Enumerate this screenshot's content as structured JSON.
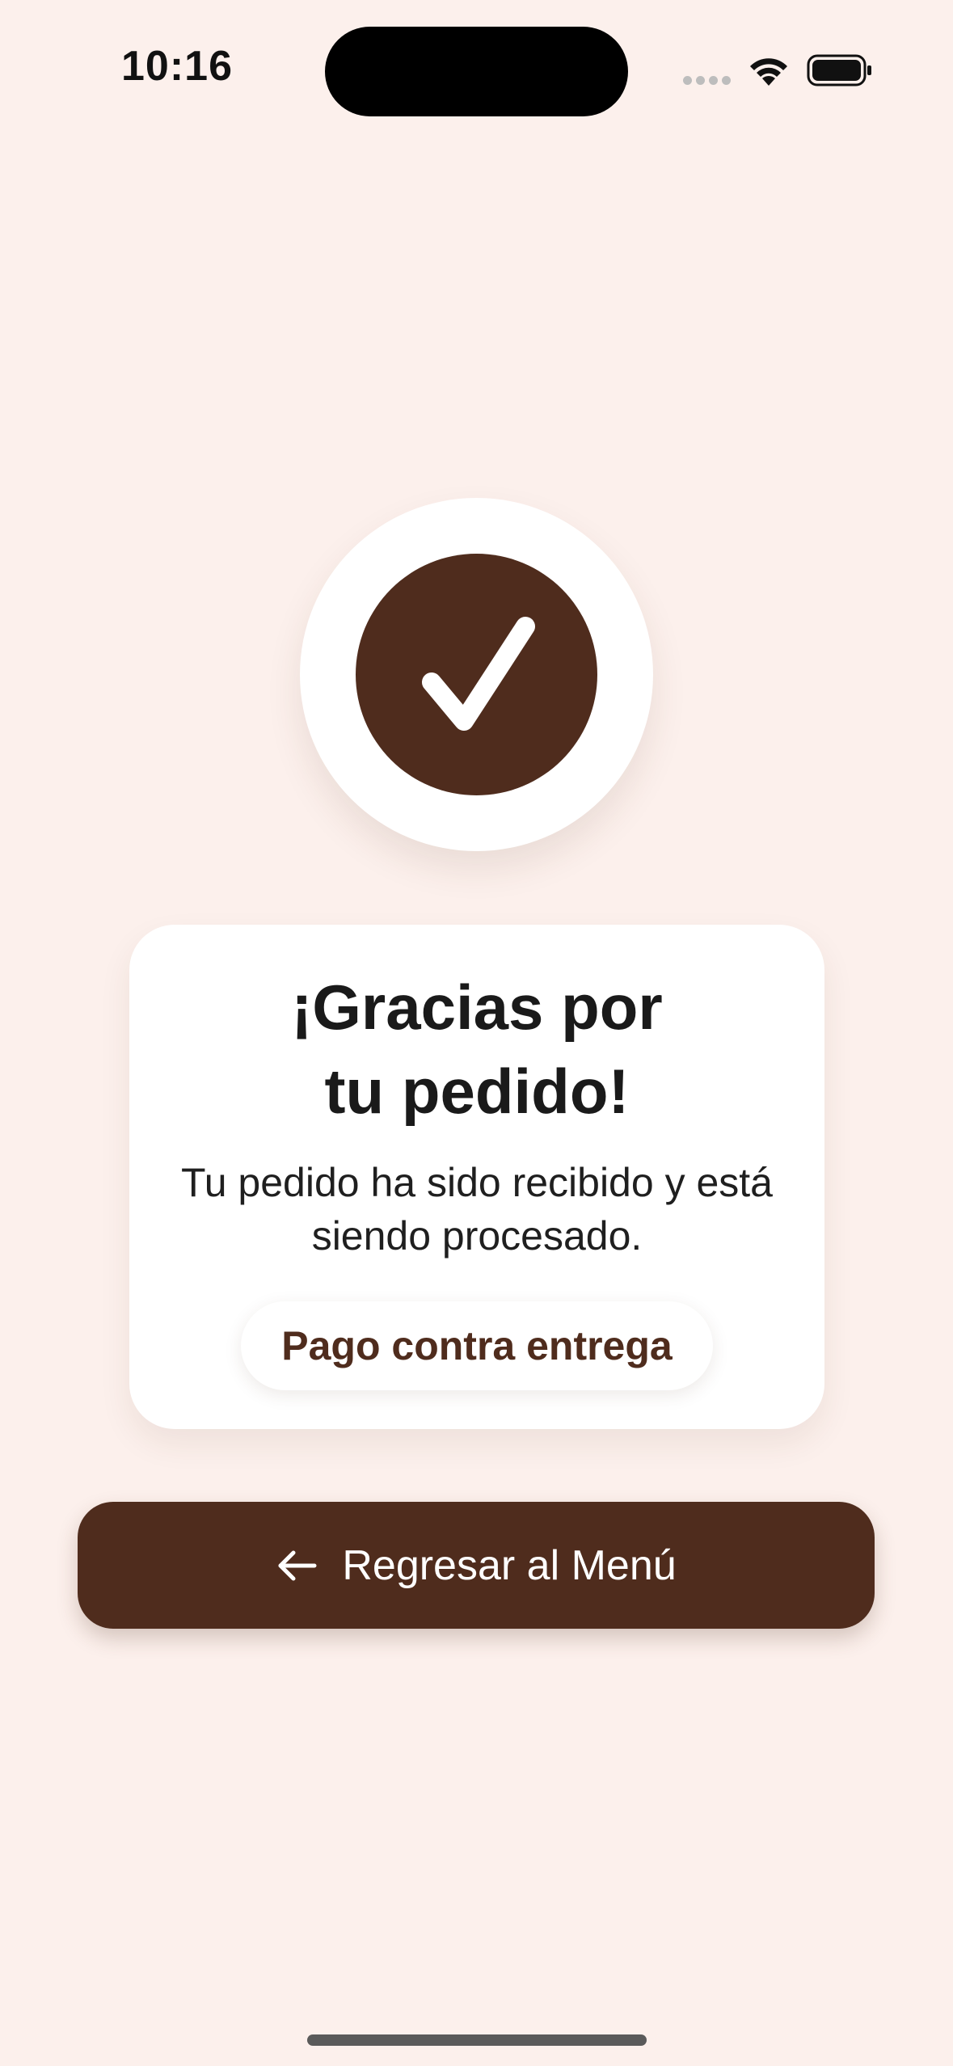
{
  "status_bar": {
    "time": "10:16"
  },
  "success_badge": {
    "icon": "checkmark-icon"
  },
  "card": {
    "title_line1": "¡Gracias por",
    "title_line2": "tu pedido!",
    "message_line1": "Tu pedido ha sido recibido y está",
    "message_line2": "siendo procesado.",
    "payment_method": "Pago contra entrega"
  },
  "back_button": {
    "label": "Regresar al Menú",
    "icon": "arrow-left-icon"
  },
  "colors": {
    "background": "#fcf0ec",
    "brand_brown": "#4f2c1d",
    "card": "#ffffff"
  }
}
